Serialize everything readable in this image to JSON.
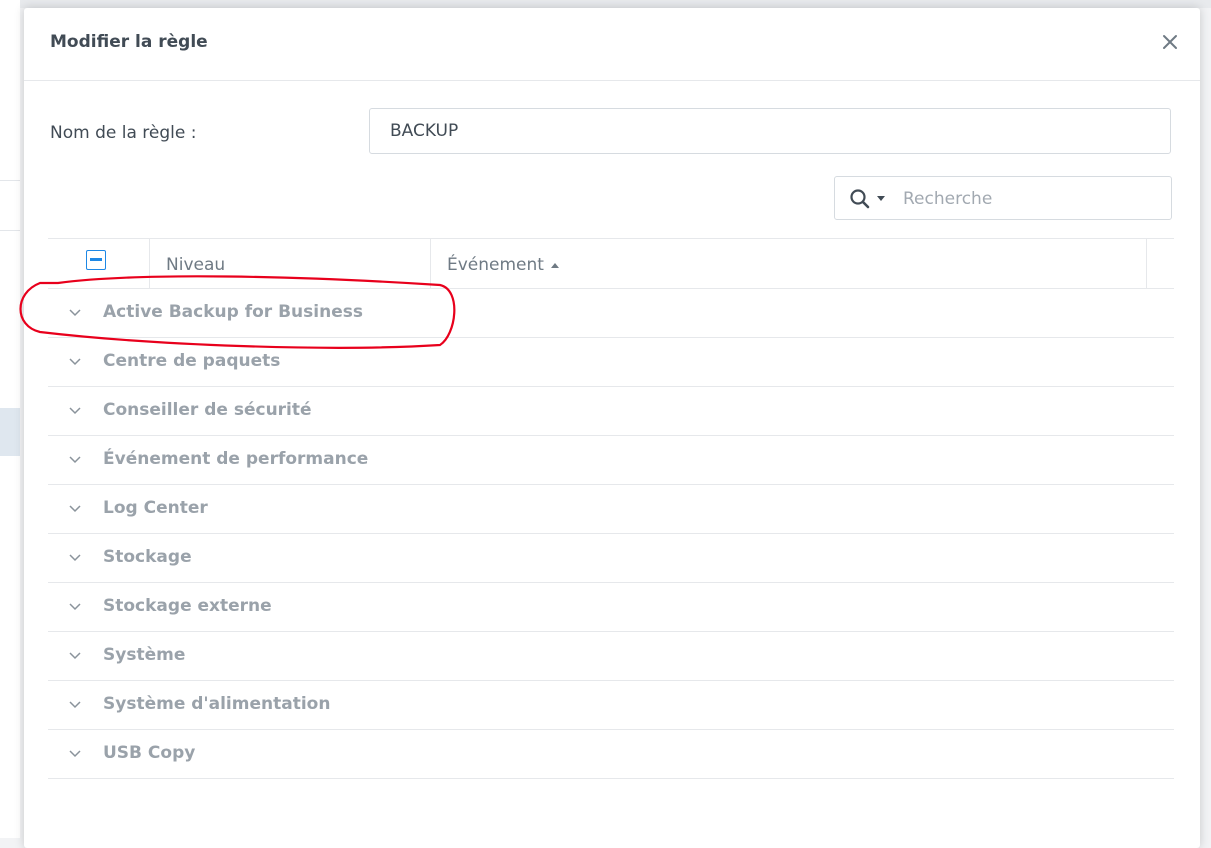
{
  "dialog": {
    "title": "Modifier la règle",
    "close_icon": "close-icon"
  },
  "form": {
    "name_label": "Nom de la règle :",
    "name_value": "BACKUP"
  },
  "search": {
    "icon": "search-icon",
    "placeholder": "Recherche"
  },
  "grid": {
    "columns": [
      "Niveau",
      "Événement"
    ],
    "sort_column": "Événement",
    "sort_direction": "ascending",
    "select_all_state": "partial",
    "groups": [
      "Active Backup for Business",
      "Centre de paquets",
      "Conseiller de sécurité",
      "Événement de performance",
      "Log Center",
      "Stockage",
      "Stockage externe",
      "Système",
      "Système d'alimentation",
      "USB Copy"
    ]
  },
  "colors": {
    "accent": "#1e88e5",
    "annotation": "#e8001c",
    "group_text": "#9aa2aa",
    "title_text": "#414b55"
  }
}
